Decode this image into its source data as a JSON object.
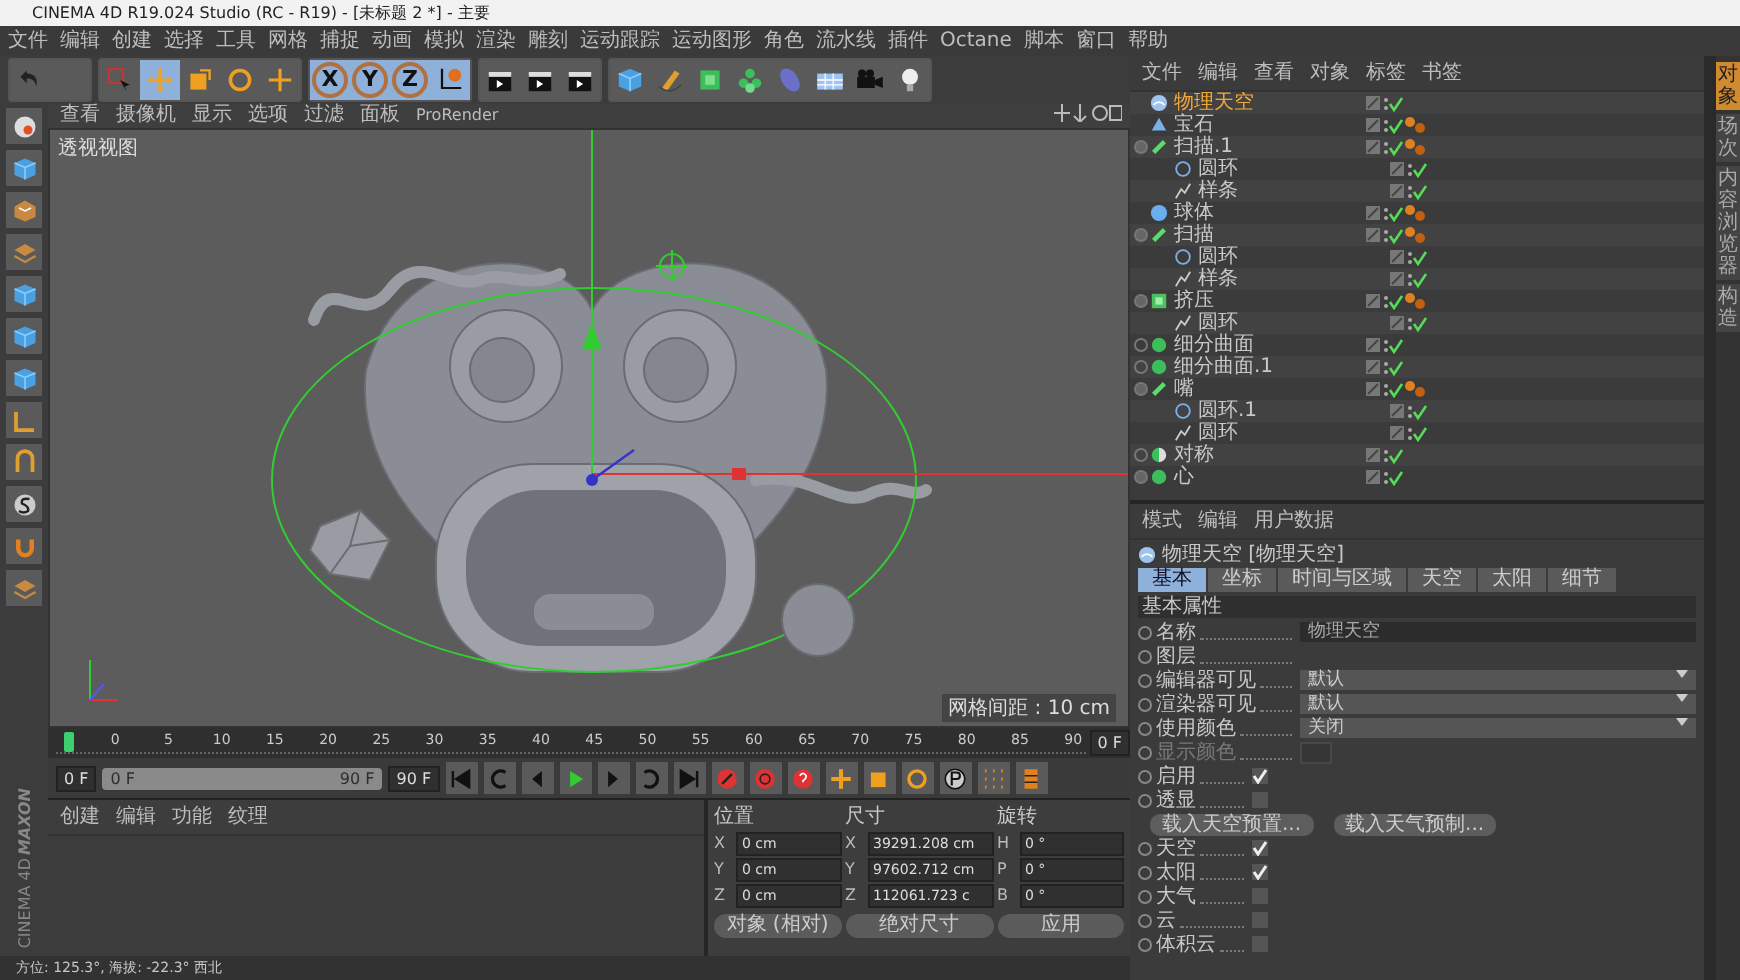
{
  "window": {
    "title": "CINEMA 4D R19.024 Studio (RC - R19) - [未标题 2 *] - 主要"
  },
  "menu": [
    "文件",
    "编辑",
    "创建",
    "选择",
    "工具",
    "网格",
    "捕捉",
    "动画",
    "模拟",
    "渲染",
    "雕刻",
    "运动跟踪",
    "运动图形",
    "角色",
    "流水线",
    "插件",
    "Octane",
    "脚本",
    "窗口",
    "帮助"
  ],
  "toolbar": [
    [
      {
        "kind": "undo",
        "active": false
      },
      {
        "kind": "blank",
        "active": false
      }
    ],
    [
      {
        "kind": "select",
        "active": false
      },
      {
        "kind": "move",
        "active": true
      },
      {
        "kind": "scale",
        "active": false
      },
      {
        "kind": "rotate",
        "active": false
      },
      {
        "kind": "add",
        "active": false
      }
    ],
    [
      {
        "kind": "axis",
        "label": "X",
        "active": true
      },
      {
        "kind": "axis",
        "label": "Y",
        "active": true
      },
      {
        "kind": "axis",
        "label": "Z",
        "active": true
      },
      {
        "kind": "coords",
        "active": true
      }
    ],
    [
      {
        "kind": "clapper",
        "active": false
      },
      {
        "kind": "clapper",
        "active": false
      },
      {
        "kind": "clapper",
        "active": false
      }
    ],
    [
      {
        "kind": "cube",
        "active": false
      },
      {
        "kind": "pen",
        "active": false
      },
      {
        "kind": "subdiv",
        "active": false
      },
      {
        "kind": "cloner",
        "active": false
      },
      {
        "kind": "deformer",
        "active": false
      },
      {
        "kind": "floor",
        "active": false
      },
      {
        "kind": "camera",
        "active": false
      },
      {
        "kind": "light",
        "active": false
      }
    ]
  ],
  "left_tools": [
    {
      "kind": "sphere"
    },
    {
      "kind": "cube"
    },
    {
      "kind": "checker"
    },
    {
      "kind": "layers"
    },
    {
      "kind": "cube"
    },
    {
      "kind": "cube"
    },
    {
      "kind": "cube"
    },
    {
      "kind": "angle"
    },
    {
      "kind": "snap"
    },
    {
      "kind": "s"
    },
    {
      "kind": "magnet"
    },
    {
      "kind": "layers"
    }
  ],
  "viewport": {
    "menu": [
      "查看",
      "摄像机",
      "显示",
      "选项",
      "过滤",
      "面板",
      "ProRender"
    ],
    "view_name": "透视视图",
    "grid_spacing": "网格间距 : 10 cm"
  },
  "timeline": {
    "ticks": [
      "0",
      "5",
      "10",
      "15",
      "20",
      "25",
      "30",
      "35",
      "40",
      "45",
      "50",
      "55",
      "60",
      "65",
      "70",
      "75",
      "80",
      "85",
      "90"
    ],
    "current": "0 F",
    "start": "0 F",
    "range_start": "0 F",
    "range_end": "90 F",
    "level": 1,
    "end": "90 F"
  },
  "materials": {
    "menu": [
      "创建",
      "编辑",
      "功能",
      "纹理"
    ]
  },
  "coordinates": {
    "headers": [
      "位置",
      "尺寸",
      "旋转"
    ],
    "rows": [
      {
        "axis": "X",
        "position": "0 cm",
        "size_axis": "X",
        "size": "39291.208 cm",
        "rot_axis": "H",
        "rotation": "0 °"
      },
      {
        "axis": "Y",
        "position": "0 cm",
        "size_axis": "Y",
        "size": "97602.712 cm",
        "rot_axis": "P",
        "rotation": "0 °"
      },
      {
        "axis": "Z",
        "position": "0 cm",
        "size_axis": "Z",
        "size": "112061.723 c",
        "rot_axis": "B",
        "rotation": "0 °"
      }
    ],
    "mode": "对象 (相对)",
    "size_mode": "绝对尺寸",
    "apply": "应用"
  },
  "logo": {
    "brand": "MAXON",
    "product": "CINEMA 4D"
  },
  "status_bar": "方位: 125.3°, 海拔: -22.3° 西北",
  "object_manager": {
    "menu": [
      "文件",
      "编辑",
      "查看",
      "对象",
      "标签",
      "书签"
    ],
    "objects": [
      {
        "name": "物理天空",
        "kind": "sky",
        "selected": true,
        "tag": false
      },
      {
        "name": "宝石",
        "kind": "gem",
        "selected": false,
        "tag": true
      },
      {
        "name": "扫描.1",
        "kind": "sweep",
        "selected": false,
        "tag": true,
        "expanded": true,
        "children": [
          {
            "name": "圆环",
            "kind": "circle",
            "selected": false,
            "tag": false
          },
          {
            "name": "样条",
            "kind": "spline",
            "selected": false,
            "tag": false
          }
        ]
      },
      {
        "name": "球体",
        "kind": "sphere",
        "selected": false,
        "tag": true
      },
      {
        "name": "扫描",
        "kind": "sweep",
        "selected": false,
        "tag": true,
        "expanded": true,
        "children": [
          {
            "name": "圆环",
            "kind": "circle",
            "selected": false,
            "tag": false
          },
          {
            "name": "样条",
            "kind": "spline",
            "selected": false,
            "tag": false
          }
        ]
      },
      {
        "name": "挤压",
        "kind": "extrude",
        "selected": false,
        "tag": true,
        "expanded": true,
        "children": [
          {
            "name": "圆环",
            "kind": "spline",
            "selected": false,
            "tag": false
          }
        ]
      },
      {
        "name": "细分曲面",
        "kind": "subdiv",
        "selected": false,
        "tag": false,
        "expanded": false
      },
      {
        "name": "细分曲面.1",
        "kind": "subdiv",
        "selected": false,
        "tag": false,
        "expanded": false
      },
      {
        "name": "嘴",
        "kind": "sweep",
        "selected": false,
        "tag": true,
        "expanded": true,
        "children": [
          {
            "name": "圆环.1",
            "kind": "circle",
            "selected": false,
            "tag": false
          },
          {
            "name": "圆环",
            "kind": "spline",
            "selected": false,
            "tag": false
          }
        ]
      },
      {
        "name": "对称",
        "kind": "symmetry",
        "selected": false,
        "tag": false,
        "expanded": false
      },
      {
        "name": "心",
        "kind": "subdiv",
        "selected": false,
        "tag": false,
        "expanded": true
      }
    ]
  },
  "side_tabs": [
    {
      "label": "对象",
      "selected": true
    },
    {
      "label": "场次",
      "selected": false
    },
    {
      "label": "内容浏览器",
      "selected": false
    },
    {
      "label": "构造",
      "selected": false
    }
  ],
  "attributes": {
    "menu": [
      "模式",
      "编辑",
      "用户数据"
    ],
    "title": "物理天空 [物理天空]",
    "tabs": [
      {
        "label": "基本",
        "selected": true
      },
      {
        "label": "坐标",
        "selected": false
      },
      {
        "label": "时间与区域",
        "selected": false
      },
      {
        "label": "天空",
        "selected": false
      },
      {
        "label": "太阳",
        "selected": false
      },
      {
        "label": "细节",
        "selected": false
      }
    ],
    "section": "基本属性",
    "rows": [
      {
        "kind": "field",
        "label": "名称",
        "value": "物理天空"
      },
      {
        "kind": "layer",
        "label": "图层"
      },
      {
        "kind": "dropdown",
        "label": "编辑器可见",
        "value": "默认"
      },
      {
        "kind": "dropdown",
        "label": "渲染器可见",
        "value": "默认"
      },
      {
        "kind": "dropdown",
        "label": "使用颜色",
        "value": "关闭"
      },
      {
        "kind": "color",
        "label": "显示颜色",
        "disabled": true
      },
      {
        "kind": "check",
        "label": "启用",
        "checked": true
      },
      {
        "kind": "check",
        "label": "透显",
        "checked": false
      },
      {
        "kind": "buttons",
        "buttons": [
          "载入天空预置...",
          "载入天气预制..."
        ]
      },
      {
        "kind": "check",
        "label": "天空",
        "checked": true
      },
      {
        "kind": "check",
        "label": "太阳",
        "checked": true
      },
      {
        "kind": "check",
        "label": "大气",
        "checked": false
      },
      {
        "kind": "check",
        "label": "云",
        "checked": false
      },
      {
        "kind": "check",
        "label": "体积云",
        "checked": false
      }
    ]
  }
}
